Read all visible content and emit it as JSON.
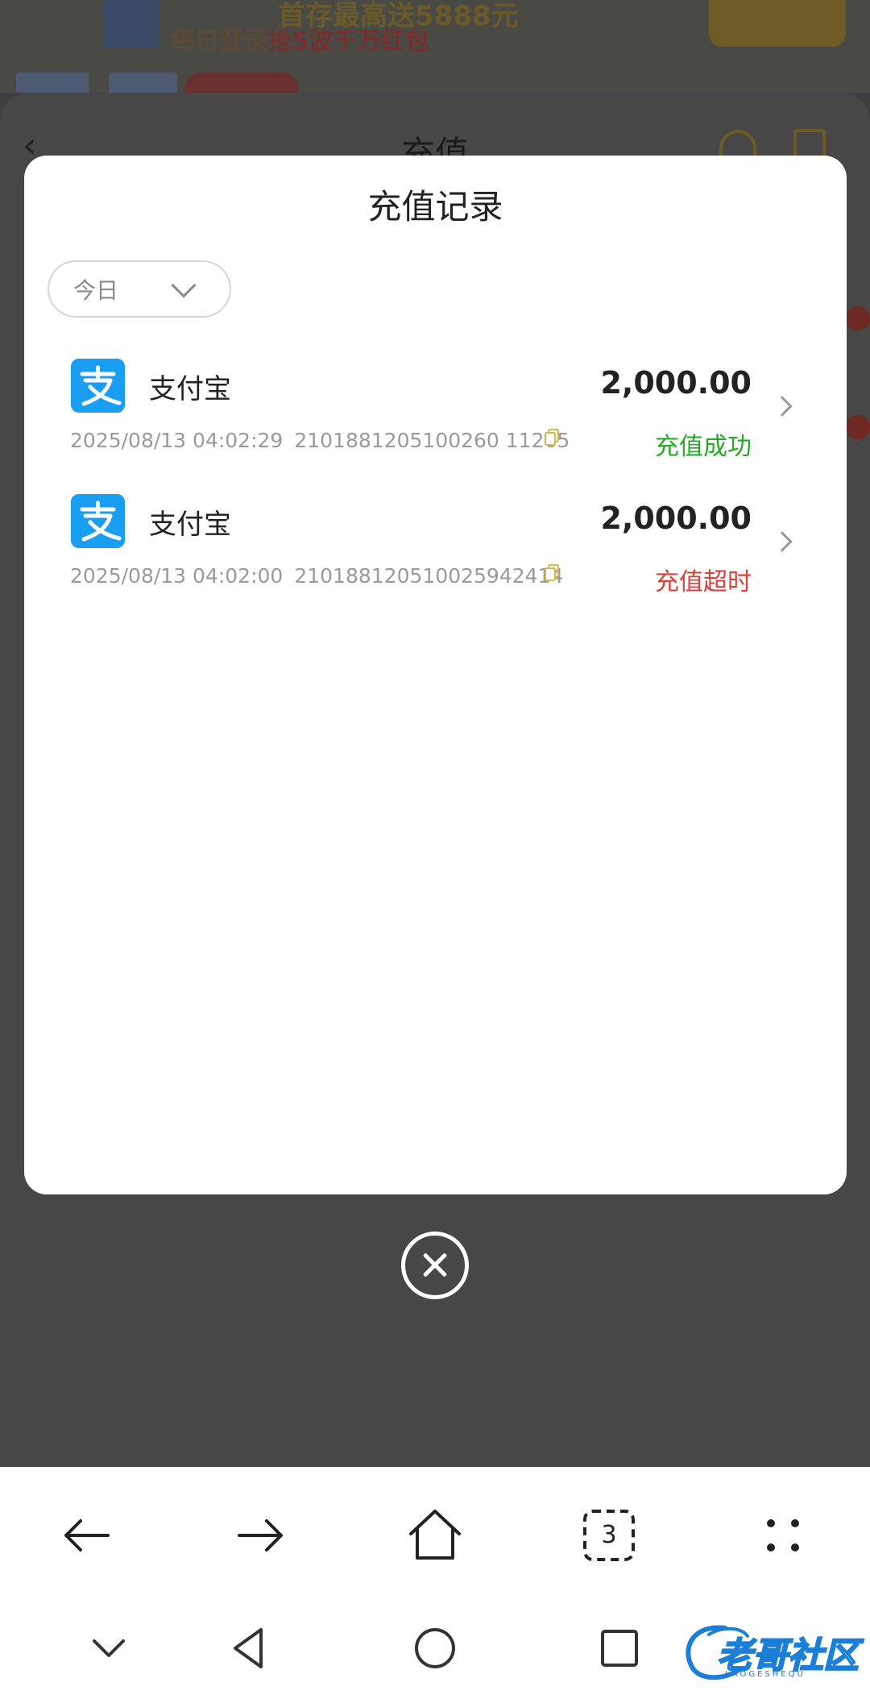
{
  "background": {
    "promo_line1": "首存最高送5888元",
    "promo_line2_prefix": "每日登录",
    "promo_line2_highlight": "抢5波千万红包",
    "page_title": "充值"
  },
  "modal": {
    "title": "充值记录",
    "date_filter": {
      "selected": "今日"
    },
    "records": [
      {
        "method": "支付宝",
        "amount": "2,000.00",
        "datetime": "2025/08/13 04:02:29",
        "order_id": "2101881205100260 11265",
        "status": "充值成功",
        "status_color": "#26a926"
      },
      {
        "method": "支付宝",
        "amount": "2,000.00",
        "datetime": "2025/08/13 04:02:00",
        "order_id": "210188120510025942414",
        "status": "充值超时",
        "status_color": "#d9403a"
      }
    ]
  },
  "browser_toolbar": {
    "items": [
      "back-icon",
      "forward-icon",
      "home-icon",
      "tabs-icon",
      "more-icon"
    ],
    "tab_count": "3"
  },
  "system_nav": {
    "items": [
      "collapse-icon",
      "back-triangle-icon",
      "home-circle-icon",
      "recents-square-icon"
    ]
  },
  "watermark": {
    "text": "老哥社区",
    "subtext": "LAOGESHEQU"
  },
  "colors": {
    "success": "#26a926",
    "timeout": "#d9403a",
    "alipay_blue": "#1a9ef1",
    "copy_icon": "#d4b84a"
  }
}
